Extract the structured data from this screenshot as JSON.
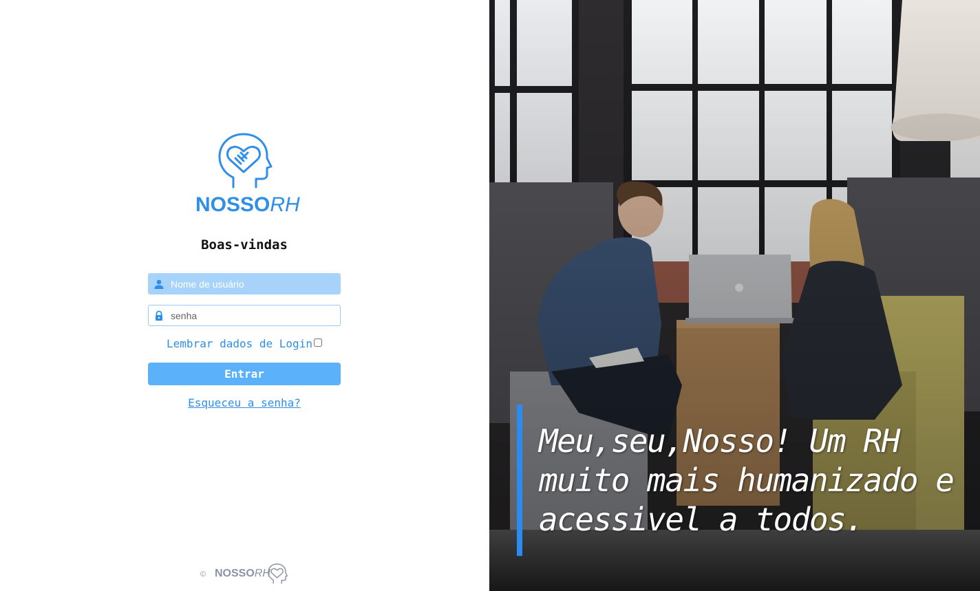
{
  "brand": {
    "name_bold": "NOSSO",
    "name_light": "RH",
    "color": "#2e8ee8"
  },
  "login": {
    "welcome": "Boas-vindas",
    "username_placeholder": "Nome de usuário",
    "username_icon": "user-icon",
    "password_placeholder": "senha",
    "password_icon": "lock-icon",
    "remember_label": "Lembrar dados de Login",
    "remember_checked": false,
    "submit_label": "Entrar",
    "forgot_label": "Esqueceu a senha?"
  },
  "footer": {
    "copyright": "©",
    "brand_bold": "NOSSO",
    "brand_light": "RH"
  },
  "hero": {
    "quote": "Meu,seu,Nosso! Um RH muito mais humanizado e acessivel a todos.",
    "accent_color": "#2a8bf0"
  }
}
